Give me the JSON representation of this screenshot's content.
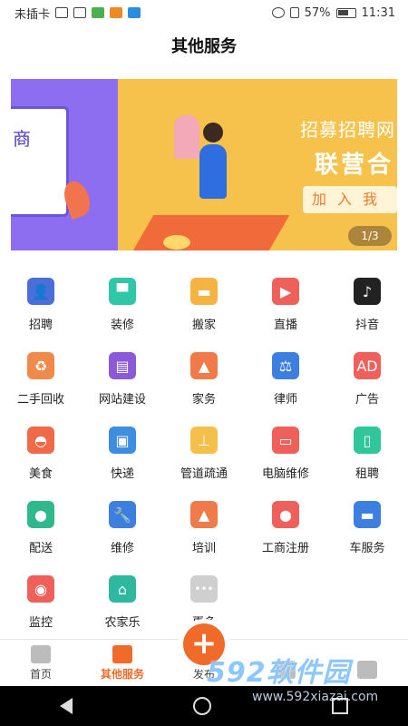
{
  "status_bar": {
    "carrier": "未插卡",
    "battery": "57%",
    "time": "11:31"
  },
  "header": {
    "title": "其他服务"
  },
  "banner": {
    "left_glyph": "商",
    "title": "招募招聘网",
    "subtitle": "联营合",
    "button": "加入我",
    "pager": "1/3"
  },
  "services": [
    {
      "label": "招聘",
      "icon": "recruit-icon",
      "color": "#4a6fd8",
      "glyph": "👤"
    },
    {
      "label": "装修",
      "icon": "paint-roller-icon",
      "color": "#2fc7a8",
      "glyph": "▀"
    },
    {
      "label": "搬家",
      "icon": "truck-icon",
      "color": "#f5b342",
      "glyph": "▬"
    },
    {
      "label": "直播",
      "icon": "video-camera-icon",
      "color": "#f0605a",
      "glyph": "▶"
    },
    {
      "label": "抖音",
      "icon": "tiktok-icon",
      "color": "#222222",
      "glyph": "♪"
    },
    {
      "label": "二手回收",
      "icon": "recycle-icon",
      "color": "#f08a4a",
      "glyph": "♻"
    },
    {
      "label": "网站建设",
      "icon": "website-icon",
      "color": "#8a5ad8",
      "glyph": "▤"
    },
    {
      "label": "家务",
      "icon": "housework-icon",
      "color": "#f07a4a",
      "glyph": "▲"
    },
    {
      "label": "律师",
      "icon": "gavel-icon",
      "color": "#3d7fe0",
      "glyph": "⚖"
    },
    {
      "label": "广告",
      "icon": "ad-icon",
      "color": "#f0605a",
      "glyph": "AD"
    },
    {
      "label": "美食",
      "icon": "food-cloche-icon",
      "color": "#f06a4a",
      "glyph": "◓"
    },
    {
      "label": "快递",
      "icon": "parcel-icon",
      "color": "#3d8ee0",
      "glyph": "▣"
    },
    {
      "label": "管道疏通",
      "icon": "plunger-icon",
      "color": "#f5c04a",
      "glyph": "⊥"
    },
    {
      "label": "电脑维修",
      "icon": "computer-repair-icon",
      "color": "#f0605a",
      "glyph": "▭"
    },
    {
      "label": "租聘",
      "icon": "door-icon",
      "color": "#2fc79a",
      "glyph": "▯"
    },
    {
      "label": "配送",
      "icon": "courier-icon",
      "color": "#2fb88a",
      "glyph": "●"
    },
    {
      "label": "维修",
      "icon": "wrench-icon",
      "color": "#3d7fe0",
      "glyph": "🔧"
    },
    {
      "label": "培训",
      "icon": "graduation-cap-icon",
      "color": "#f07a4a",
      "glyph": "▲"
    },
    {
      "label": "工商注册",
      "icon": "business-register-icon",
      "color": "#f0605a",
      "glyph": "●"
    },
    {
      "label": "车服务",
      "icon": "car-icon",
      "color": "#3d7fe0",
      "glyph": "▬"
    },
    {
      "label": "监控",
      "icon": "surveillance-camera-icon",
      "color": "#f0605a",
      "glyph": "◉"
    },
    {
      "label": "农家乐",
      "icon": "farmhouse-icon",
      "color": "#2fb8a0",
      "glyph": "⌂"
    },
    {
      "label": "更多",
      "icon": "more-icon",
      "color": "#cfcfcf",
      "glyph": "•••"
    }
  ],
  "tabs": [
    {
      "label": "首页",
      "icon": "home-icon",
      "active": false
    },
    {
      "label": "其他服务",
      "icon": "other-services-icon",
      "active": true
    },
    {
      "label": "发布",
      "icon": "plus-icon",
      "active": false,
      "center": true
    },
    {
      "label": "",
      "icon": "wallet-icon",
      "active": false
    },
    {
      "label": "",
      "icon": "profile-icon",
      "active": false
    }
  ],
  "watermark": {
    "main": "592软件园",
    "url": "www.592xiazai.com"
  },
  "colors": {
    "accent": "#f06a2a",
    "banner_bg": "#f6c24b",
    "banner_left": "#8d6df0"
  }
}
